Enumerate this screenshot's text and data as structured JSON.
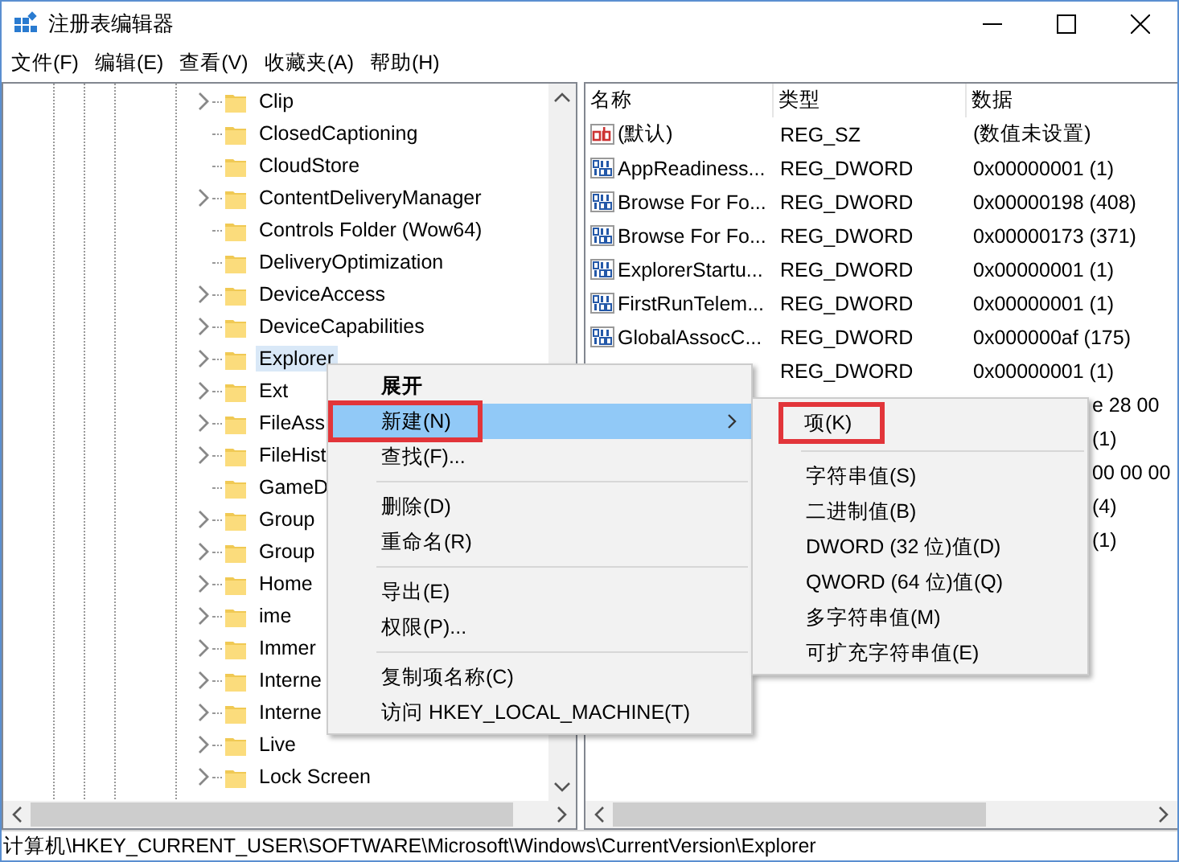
{
  "window": {
    "title": "注册表编辑器"
  },
  "menu_bar": [
    "文件(F)",
    "编辑(E)",
    "查看(V)",
    "收藏夹(A)",
    "帮助(H)"
  ],
  "tree": [
    {
      "label": "Clip",
      "expandable": true,
      "selected": false
    },
    {
      "label": "ClosedCaptioning",
      "expandable": false,
      "selected": false
    },
    {
      "label": "CloudStore",
      "expandable": false,
      "selected": false
    },
    {
      "label": "ContentDeliveryManager",
      "expandable": true,
      "selected": false
    },
    {
      "label": "Controls Folder (Wow64)",
      "expandable": false,
      "selected": false
    },
    {
      "label": "DeliveryOptimization",
      "expandable": false,
      "selected": false
    },
    {
      "label": "DeviceAccess",
      "expandable": true,
      "selected": false
    },
    {
      "label": "DeviceCapabilities",
      "expandable": true,
      "selected": false
    },
    {
      "label": "Explorer",
      "expandable": true,
      "selected": true
    },
    {
      "label": "Ext",
      "expandable": true,
      "selected": false
    },
    {
      "label": "FileAss",
      "expandable": true,
      "selected": false
    },
    {
      "label": "FileHist",
      "expandable": true,
      "selected": false
    },
    {
      "label": "GameD",
      "expandable": false,
      "selected": false
    },
    {
      "label": "Group",
      "expandable": true,
      "selected": false
    },
    {
      "label": "Group",
      "expandable": true,
      "selected": false
    },
    {
      "label": "Home",
      "expandable": true,
      "selected": false
    },
    {
      "label": "ime",
      "expandable": true,
      "selected": false
    },
    {
      "label": "Immer",
      "expandable": true,
      "selected": false
    },
    {
      "label": "Interne",
      "expandable": true,
      "selected": false
    },
    {
      "label": "Interne",
      "expandable": true,
      "selected": false
    },
    {
      "label": "Live",
      "expandable": true,
      "selected": false
    },
    {
      "label": "Lock Screen",
      "expandable": true,
      "selected": false
    }
  ],
  "table": {
    "columns": [
      "名称",
      "类型",
      "数据"
    ],
    "rows": [
      {
        "kind": "string",
        "name": "(默认)",
        "type": "REG_SZ",
        "data": "(数值未设置)"
      },
      {
        "kind": "dword",
        "name": "AppReadiness...",
        "type": "REG_DWORD",
        "data": "0x00000001 (1)"
      },
      {
        "kind": "dword",
        "name": "Browse For Fo...",
        "type": "REG_DWORD",
        "data": "0x00000198 (408)"
      },
      {
        "kind": "dword",
        "name": "Browse For Fo...",
        "type": "REG_DWORD",
        "data": "0x00000173 (371)"
      },
      {
        "kind": "dword",
        "name": "ExplorerStartu...",
        "type": "REG_DWORD",
        "data": "0x00000001 (1)"
      },
      {
        "kind": "dword",
        "name": "FirstRunTelem...",
        "type": "REG_DWORD",
        "data": "0x00000001 (1)"
      },
      {
        "kind": "dword",
        "name": "GlobalAssocC...",
        "type": "REG_DWORD",
        "data": "0x000000af (175)"
      },
      {
        "kind": "hidden",
        "type": "REG_DWORD",
        "data": "0x00000001 (1)"
      },
      {
        "kind": "hidden",
        "data": "e 28 00"
      },
      {
        "kind": "hidden",
        "data": "(1)"
      },
      {
        "kind": "hidden",
        "data": "00 00 00"
      },
      {
        "kind": "hidden",
        "data": "(4)"
      },
      {
        "kind": "hidden",
        "data": "(1)"
      }
    ]
  },
  "context_menu": {
    "items": [
      {
        "kind": "default",
        "label": "展开",
        "selected": false,
        "annotated": false,
        "submenu": false
      },
      {
        "kind": "item",
        "label": "新建(N)",
        "selected": true,
        "annotated": true,
        "submenu": true
      },
      {
        "kind": "item",
        "label": "查找(F)...",
        "selected": false,
        "annotated": false,
        "submenu": false
      },
      {
        "kind": "separator"
      },
      {
        "kind": "item",
        "label": "删除(D)",
        "selected": false,
        "annotated": false,
        "submenu": false
      },
      {
        "kind": "item",
        "label": "重命名(R)",
        "selected": false,
        "annotated": false,
        "submenu": false
      },
      {
        "kind": "separator"
      },
      {
        "kind": "item",
        "label": "导出(E)",
        "selected": false,
        "annotated": false,
        "submenu": false
      },
      {
        "kind": "item",
        "label": "权限(P)...",
        "selected": false,
        "annotated": false,
        "submenu": false
      },
      {
        "kind": "separator"
      },
      {
        "kind": "item",
        "label": "复制项名称(C)",
        "selected": false,
        "annotated": false,
        "submenu": false
      },
      {
        "kind": "item",
        "label": "访问 HKEY_LOCAL_MACHINE(T)",
        "selected": false,
        "annotated": false,
        "submenu": false
      }
    ]
  },
  "submenu": {
    "items": [
      {
        "kind": "item",
        "label": "项(K)",
        "selected": false,
        "annotated": true,
        "submenu": false
      },
      {
        "kind": "separator"
      },
      {
        "kind": "item",
        "label": "字符串值(S)",
        "selected": false,
        "annotated": false,
        "submenu": false
      },
      {
        "kind": "item",
        "label": "二进制值(B)",
        "selected": false,
        "annotated": false,
        "submenu": false
      },
      {
        "kind": "item",
        "label": "DWORD (32 位)值(D)",
        "selected": false,
        "annotated": false,
        "submenu": false
      },
      {
        "kind": "item",
        "label": "QWORD (64 位)值(Q)",
        "selected": false,
        "annotated": false,
        "submenu": false
      },
      {
        "kind": "item",
        "label": "多字符串值(M)",
        "selected": false,
        "annotated": false,
        "submenu": false
      },
      {
        "kind": "item",
        "label": "可扩充字符串值(E)",
        "selected": false,
        "annotated": false,
        "submenu": false
      }
    ]
  },
  "status_bar": "计算机\\HKEY_CURRENT_USER\\SOFTWARE\\Microsoft\\Windows\\CurrentVersion\\Explorer"
}
